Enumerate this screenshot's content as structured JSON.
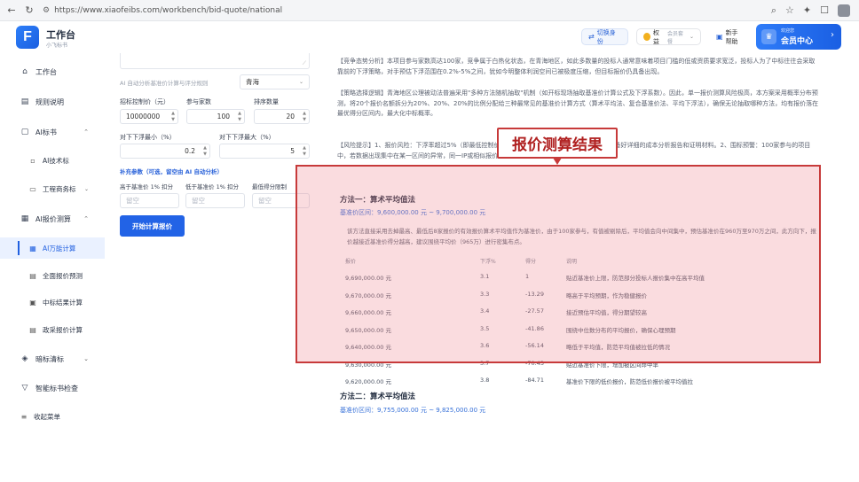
{
  "browser": {
    "url": "https://www.xiaofeibs.com/workbench/bid-quote/national"
  },
  "app": {
    "logo_letter": "F",
    "title": "工作台",
    "subtitle": "小飞标书"
  },
  "header": {
    "switch_identity": "切换身份",
    "quota_label": "权益",
    "quota_level": "会员套餐",
    "help": "新手帮助",
    "member_small": "欢迎您",
    "member_main": "会员中心"
  },
  "sidebar": {
    "workbench": "工作台",
    "rules": "规则说明",
    "ai_bid": "AI标书",
    "ai_tech": "AI技术标",
    "eng_bid": "工程商务标",
    "ai_quote": "AI报价测算",
    "ai_wan": "AI万能计算",
    "full_quote": "全面报价预测",
    "win_calc": "中标结果计算",
    "gov_quote": "政采报价计算",
    "dark_bid": "暗标清标",
    "smart_check": "智能标书检查",
    "collapse": "收起菜单"
  },
  "form": {
    "region_label": "AI 自动分析基准价计算与评分规则",
    "region_value": "青海",
    "ceiling_label": "招标控制价（元）",
    "ceiling_value": "10000000",
    "bidders_label": "参与家数",
    "bidders_value": "100",
    "rank_label": "排序数量",
    "rank_value": "20",
    "down_min_label": "对下下浮最小（%）",
    "down_min_value": "0.2",
    "down_max_label": "对下下浮最大（%）",
    "down_max_value": "5",
    "extra_label": "补充参数（可选，留空由 AI 自动分析）",
    "above_label": "高于基准价 1% 扣分",
    "below_label": "低于基准价 1% 扣分",
    "min_score_label": "最低得分限制",
    "placeholder": "留空",
    "submit": "开始计算报价"
  },
  "results": {
    "p1": "【竞争态势分析】本项目参与家数高达100家，竞争属于白热化状态，在青海地区，如此多数量的投标人通常意味着项目门槛的低或资质要求宽泛，投标人为了中标往往会采取靠前的下浮策略，对手预估下浮范围在0.2%-5%之间，犹如今明整体利润空间已被极度压缩，但目标报价仍具备出现。",
    "p2": "【策略选择逻辑】青海地区公理被动法普遍采用\"多种方法随机抽取\"机制（如开标现场抽取基准价计算公式及下浮系数）。因此，单一报价测算风险极高，本方案采用概率分布预测，将20个报价名额拆分为20%、20%、20%的比例分配给三种最常见的基准价计算方式（算术平均法、复合基准价法、平均下浮法），确保无论抽取哪种方法，均有报价落在最优得分区间内，最大化中标概率。",
    "p3": "【风险提示】1、报价风险：下浮率超过5%（即最低控制价），报价存在\"低于成本价\"审查，需提前准备好详细的成本分析报告和证明材料。2、围标预警：100家参与的项目中，若数据出现集中在某一区间的异常，同一IP或相似报价，需警惕，建议保持报价独立性。3、",
    "callout": "报价测算结果",
    "m1_title": "方法一：算术平均值法",
    "m1_range": "基准价区间：9,600,000.00 元 ~ 9,700,000.00 元",
    "m1_desc": "该方法直接采用去掉最高、最低后8家报价的有效报价算术平均值作为基准价，由于100家参与，有值被剔除后，平均值会向中间集中，预估基准价在960万至970万之间，此方向下，报价越接近基准价得分越高，建议围绕平均价（965万）进行密集布点。",
    "table_headers": [
      "报价",
      "下浮%",
      "得分",
      "说明"
    ],
    "rows": [
      {
        "price": "9,690,000.00 元",
        "down": "3.1",
        "score": "1",
        "note": "贴近基准价上限，防范部分投标人报价集中在高平均值"
      },
      {
        "price": "9,670,000.00 元",
        "down": "3.3",
        "score": "-13.29",
        "note": "略高于平均预期，作为稳健报价"
      },
      {
        "price": "9,660,000.00 元",
        "down": "3.4",
        "score": "-27.57",
        "note": "接近预估平均值，得分期望较高"
      },
      {
        "price": "9,650,000.00 元",
        "down": "3.5",
        "score": "-41.86",
        "note": "围绕中位数分布的平均报价，确保心理预期"
      },
      {
        "price": "9,640,000.00 元",
        "down": "3.6",
        "score": "-56.14",
        "note": "略低于平均值，防范平均值被拉低的情况"
      },
      {
        "price": "9,630,000.00 元",
        "down": "3.7",
        "score": "-70.43",
        "note": "贴近基准价下限，增加被区间命中率"
      },
      {
        "price": "9,620,000.00 元",
        "down": "3.8",
        "score": "-84.71",
        "note": "基准价下限的低价报价，防范低价报价被平均值拉"
      }
    ],
    "m2_title": "方法二：算术平均值法",
    "m2_range": "基准价区间：9,755,000.00 元 ~ 9,825,000.00 元"
  }
}
